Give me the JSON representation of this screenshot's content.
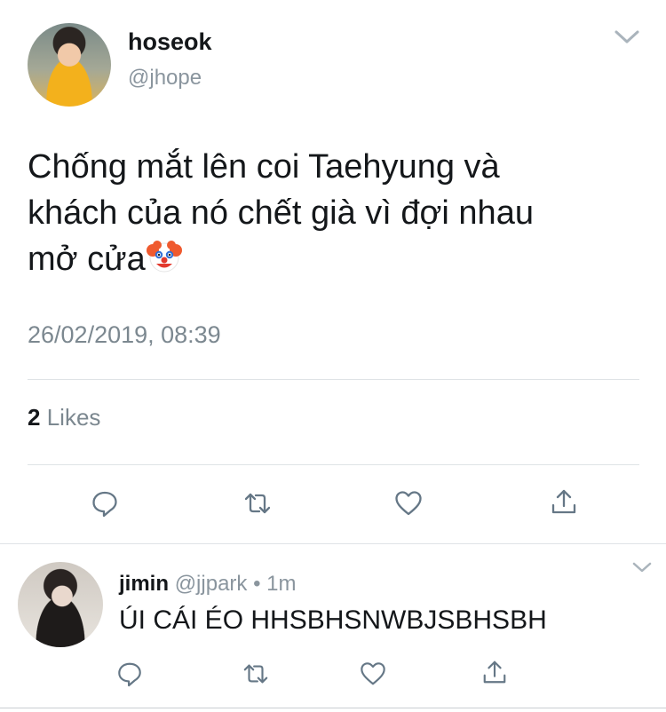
{
  "tweet": {
    "display_name": "hoseok",
    "handle": "@jhope",
    "text_line1": "Chống mắt lên coi Taehyung và",
    "text_line2": "khách của nó chết già vì đợi nhau",
    "text_line3": "mở cửa",
    "emoji": "clown-face-icon",
    "timestamp": "26/02/2019, 08:39",
    "likes_count": "2",
    "likes_label": "Likes"
  },
  "reply": {
    "display_name": "jimin",
    "handle": "@jjpark",
    "separator": "•",
    "time": "1m",
    "text": "ÚI CÁI ÉO HHSBHSNWBJSBHSBH"
  },
  "actions": [
    "reply-icon",
    "retweet-icon",
    "like-icon",
    "share-icon"
  ],
  "colors": {
    "text": "#14171a",
    "secondary": "#7c8890",
    "icon": "#657786",
    "divider": "#dfe3e6"
  }
}
